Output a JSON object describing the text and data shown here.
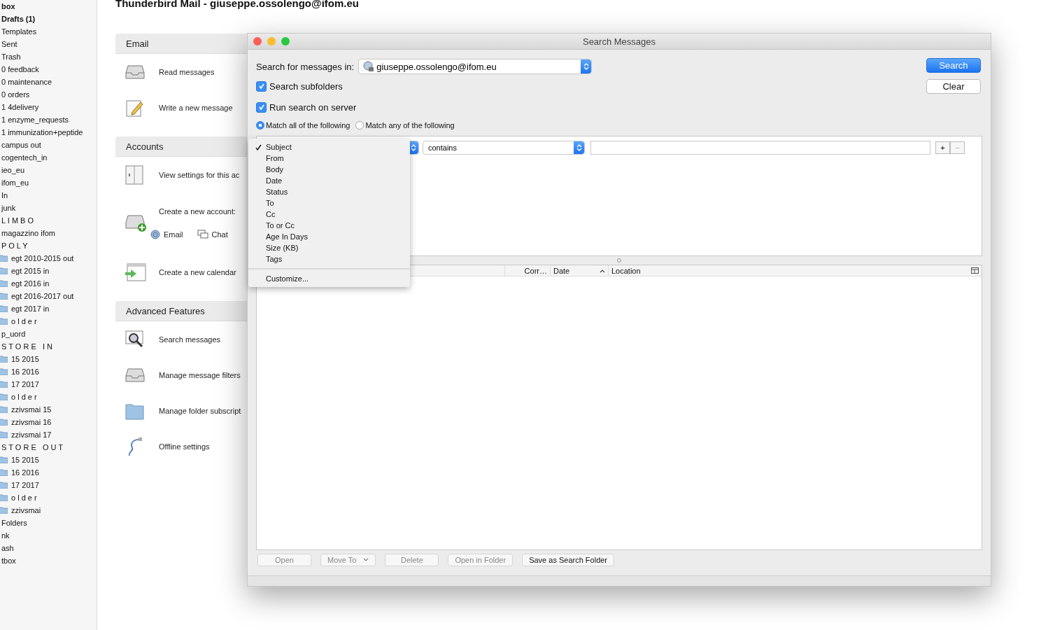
{
  "app_title": "Thunderbird Mail - giuseppe.ossolengo@ifom.eu",
  "sidebar": {
    "items": [
      {
        "label": "box",
        "kind": "plain",
        "bold": true
      },
      {
        "label": "Drafts (1)",
        "kind": "plain",
        "bold": true
      },
      {
        "label": "Templates",
        "kind": "plain",
        "bold": false
      },
      {
        "label": "Sent",
        "kind": "plain",
        "bold": false
      },
      {
        "label": "Trash",
        "kind": "plain",
        "bold": false
      },
      {
        "label": "0 feedback",
        "kind": "plain",
        "bold": false
      },
      {
        "label": "0 maintenance",
        "kind": "plain",
        "bold": false
      },
      {
        "label": "0 orders",
        "kind": "plain",
        "bold": false
      },
      {
        "label": "1 4delivery",
        "kind": "plain",
        "bold": false
      },
      {
        "label": "1 enzyme_requests",
        "kind": "plain",
        "bold": false
      },
      {
        "label": "1 immunization+peptide",
        "kind": "plain",
        "bold": false
      },
      {
        "label": "campus out",
        "kind": "plain",
        "bold": false
      },
      {
        "label": "cogentech_in",
        "kind": "plain",
        "bold": false
      },
      {
        "label": "ieo_eu",
        "kind": "plain",
        "bold": false
      },
      {
        "label": "ifom_eu",
        "kind": "plain",
        "bold": false
      },
      {
        "label": "In",
        "kind": "plain",
        "bold": false
      },
      {
        "label": "junk",
        "kind": "plain",
        "bold": false
      },
      {
        "label": "L I M B O",
        "kind": "plain",
        "bold": false
      },
      {
        "label": "magazzino ifom",
        "kind": "plain",
        "bold": false
      },
      {
        "label": "P O L Y",
        "kind": "plain",
        "bold": false
      },
      {
        "label": "egt 2010-2015 out",
        "kind": "folder",
        "bold": false
      },
      {
        "label": "egt 2015 in",
        "kind": "folder",
        "bold": false
      },
      {
        "label": "egt 2016 in",
        "kind": "folder",
        "bold": false
      },
      {
        "label": "egt 2016-2017 out",
        "kind": "folder",
        "bold": false
      },
      {
        "label": "egt 2017 in",
        "kind": "folder",
        "bold": false
      },
      {
        "label": "o l d e r",
        "kind": "folder",
        "bold": false
      },
      {
        "label": "p_uord",
        "kind": "plain",
        "bold": false
      },
      {
        "label": "S T O R E   I N",
        "kind": "plain",
        "bold": false
      },
      {
        "label": "15 2015",
        "kind": "folder",
        "bold": false
      },
      {
        "label": "16 2016",
        "kind": "folder",
        "bold": false
      },
      {
        "label": "17 2017",
        "kind": "folder",
        "bold": false
      },
      {
        "label": "o l d e r",
        "kind": "folder",
        "bold": false
      },
      {
        "label": "zzivsmai 15",
        "kind": "folder",
        "bold": false
      },
      {
        "label": "zzivsmai 16",
        "kind": "folder",
        "bold": false
      },
      {
        "label": "zzivsmai 17",
        "kind": "folder",
        "bold": false
      },
      {
        "label": "S T O R E   O U T",
        "kind": "plain",
        "bold": false
      },
      {
        "label": "15 2015",
        "kind": "folder",
        "bold": false
      },
      {
        "label": "16 2016",
        "kind": "folder",
        "bold": false
      },
      {
        "label": "17 2017",
        "kind": "folder",
        "bold": false
      },
      {
        "label": "o l d e r",
        "kind": "folder",
        "bold": false
      },
      {
        "label": "zzivsmai",
        "kind": "folder",
        "bold": false
      },
      {
        "label": "Folders",
        "kind": "plain",
        "bold": false
      },
      {
        "label": "nk",
        "kind": "plain",
        "bold": false
      },
      {
        "label": "ash",
        "kind": "plain",
        "bold": false
      },
      {
        "label": "tbox",
        "kind": "plain",
        "bold": false
      }
    ]
  },
  "sections": [
    {
      "title": "Email",
      "items": [
        {
          "kind": "read",
          "label": "Read messages"
        },
        {
          "kind": "write",
          "label": "Write a new message"
        }
      ]
    },
    {
      "title": "Accounts",
      "items": [
        {
          "kind": "settings",
          "label": "View settings for this ac"
        },
        {
          "kind": "new-account",
          "label": "Create a new account:",
          "links": [
            {
              "kind": "email",
              "label": "Email"
            },
            {
              "kind": "chat",
              "label": "Chat"
            }
          ]
        },
        {
          "kind": "calendar",
          "label": "Create a new calendar"
        }
      ]
    },
    {
      "title": "Advanced Features",
      "items": [
        {
          "kind": "search",
          "label": "Search messages"
        },
        {
          "kind": "filters",
          "label": "Manage message filters"
        },
        {
          "kind": "subscribe",
          "label": "Manage folder subscript"
        },
        {
          "kind": "offline",
          "label": "Offline settings"
        }
      ]
    }
  ],
  "dialog": {
    "title": "Search Messages",
    "search_in": {
      "label": "Search for messages in:",
      "value": "giuseppe.ossolengo@ifom.eu"
    },
    "buttons": [
      {
        "label": "Search",
        "default": true
      },
      {
        "label": "Clear",
        "default": false
      }
    ],
    "checkboxes": [
      {
        "label": "Search subfolders",
        "checked": true
      },
      {
        "label": "Run search on server",
        "checked": true
      }
    ],
    "radios": [
      {
        "label": "Match all of the following",
        "selected": true
      },
      {
        "label": "Match any of the following",
        "selected": false
      }
    ],
    "rule": {
      "operator": "contains",
      "attribute_menu": [
        {
          "label": "Subject",
          "selected": true
        },
        {
          "label": "From",
          "selected": false
        },
        {
          "label": "Body",
          "selected": false
        },
        {
          "label": "Date",
          "selected": false
        },
        {
          "label": "Status",
          "selected": false
        },
        {
          "label": "To",
          "selected": false
        },
        {
          "label": "Cc",
          "selected": false
        },
        {
          "label": "To or Cc",
          "selected": false
        },
        {
          "label": "Age In Days",
          "selected": false
        },
        {
          "label": "Size (KB)",
          "selected": false
        },
        {
          "label": "Tags",
          "selected": false
        }
      ],
      "customize": "Customize...",
      "add": "+",
      "remove": "−"
    },
    "columns": [
      {
        "label": "Corr…",
        "sorted": false
      },
      {
        "label": "Date",
        "sorted": true
      },
      {
        "label": "Location",
        "sorted": false
      }
    ],
    "actions": [
      {
        "label": "Open",
        "disabled": true,
        "kind": "button"
      },
      {
        "label": "Move To",
        "disabled": true,
        "kind": "dropdown"
      },
      {
        "label": "Delete",
        "disabled": true,
        "kind": "button"
      },
      {
        "label": "Open in Folder",
        "disabled": true,
        "kind": "button"
      },
      {
        "label": "Save as Search Folder",
        "disabled": false,
        "kind": "button"
      }
    ]
  }
}
